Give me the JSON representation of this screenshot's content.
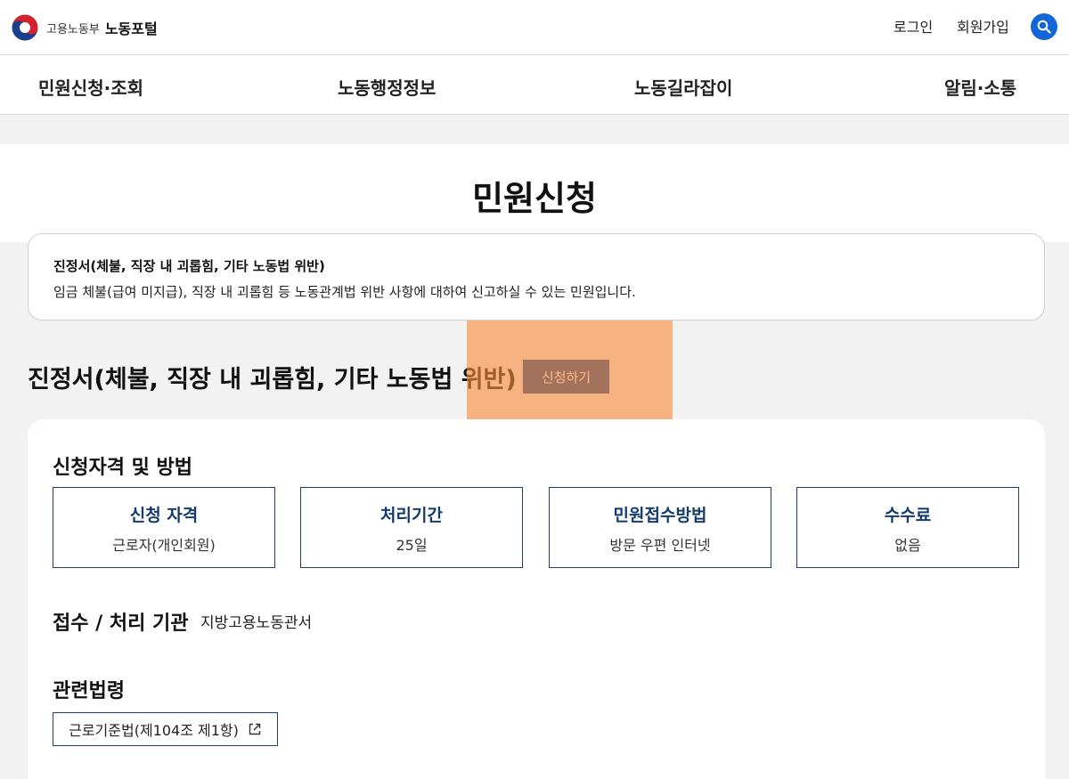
{
  "header": {
    "ministry": "고용노동부",
    "portal": "노동포털",
    "login": "로그인",
    "signup": "회원가입",
    "search_icon": "search-icon"
  },
  "nav": {
    "items": [
      {
        "label": "민원신청·조회"
      },
      {
        "label": "노동행정정보"
      },
      {
        "label": "노동길라잡이"
      },
      {
        "label": "알림·소통"
      }
    ]
  },
  "page": {
    "title": "민원신청"
  },
  "info": {
    "title": "진정서(체불, 직장 내 괴롭힘, 기타 노동법 위반)",
    "description": "임금 체불(급여 미지급), 직장 내 괴롭힘 등 노동관계법 위반 사항에 대하여 신고하실 수 있는 민원입니다."
  },
  "section": {
    "heading": "진정서(체불, 직장 내 괴롭힘, 기타 노동법 위반)",
    "apply_button": "신청하기"
  },
  "eligibility": {
    "heading": "신청자격 및 방법",
    "tiles": [
      {
        "label": "신청 자격",
        "value": "근로자(개인회원)"
      },
      {
        "label": "처리기간",
        "value": "25일"
      },
      {
        "label": "민원접수방법",
        "value": "방문 우편 인터넷"
      },
      {
        "label": "수수료",
        "value": "없음"
      }
    ]
  },
  "agency": {
    "heading": "접수 / 처리 기관",
    "value": "지방고용노동관서"
  },
  "law": {
    "heading": "관련법령",
    "button": "근로기준법(제104조 제1항)",
    "icon": "external-link-icon"
  },
  "colors": {
    "primary_blue": "#1366d6",
    "navy": "#1a4891",
    "tile_border": "#1c3f6e",
    "highlight": "#f88c3c"
  }
}
